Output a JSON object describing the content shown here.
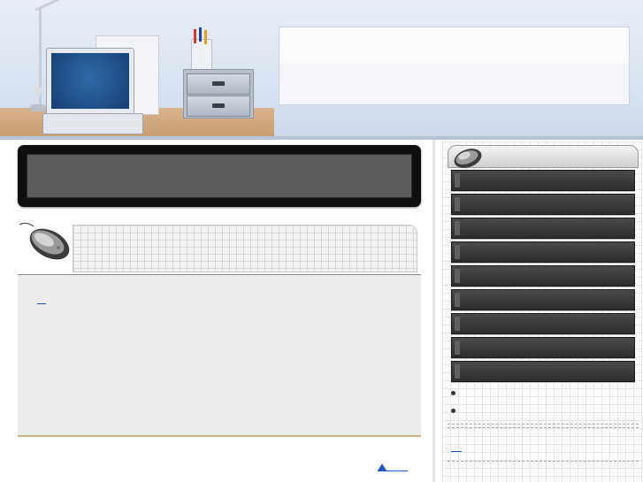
{
  "header": {
    "title": "",
    "subtitle": ""
  },
  "banner": {
    "text": ""
  },
  "content": {
    "heading": "",
    "link_text": "",
    "body": ""
  },
  "back_to_top": {
    "label": ""
  },
  "sidebar": {
    "menu_items": [
      {
        "label": ""
      },
      {
        "label": ""
      },
      {
        "label": ""
      },
      {
        "label": ""
      },
      {
        "label": ""
      },
      {
        "label": ""
      },
      {
        "label": ""
      },
      {
        "label": ""
      },
      {
        "label": ""
      }
    ],
    "bullets": [
      {
        "text": ""
      },
      {
        "text": ""
      }
    ],
    "link_text": ""
  },
  "colors": {
    "header_bg": "#dbe4f2",
    "banner_bg": "#0f0f0f",
    "menu_bg": "#2d2d2d",
    "link": "#1a4fb8",
    "content_bg": "#ececec"
  },
  "icons": [
    "desk-lamp-icon",
    "laptop-icon",
    "drawer-icon",
    "computer-mouse-icon",
    "up-arrow-icon"
  ]
}
